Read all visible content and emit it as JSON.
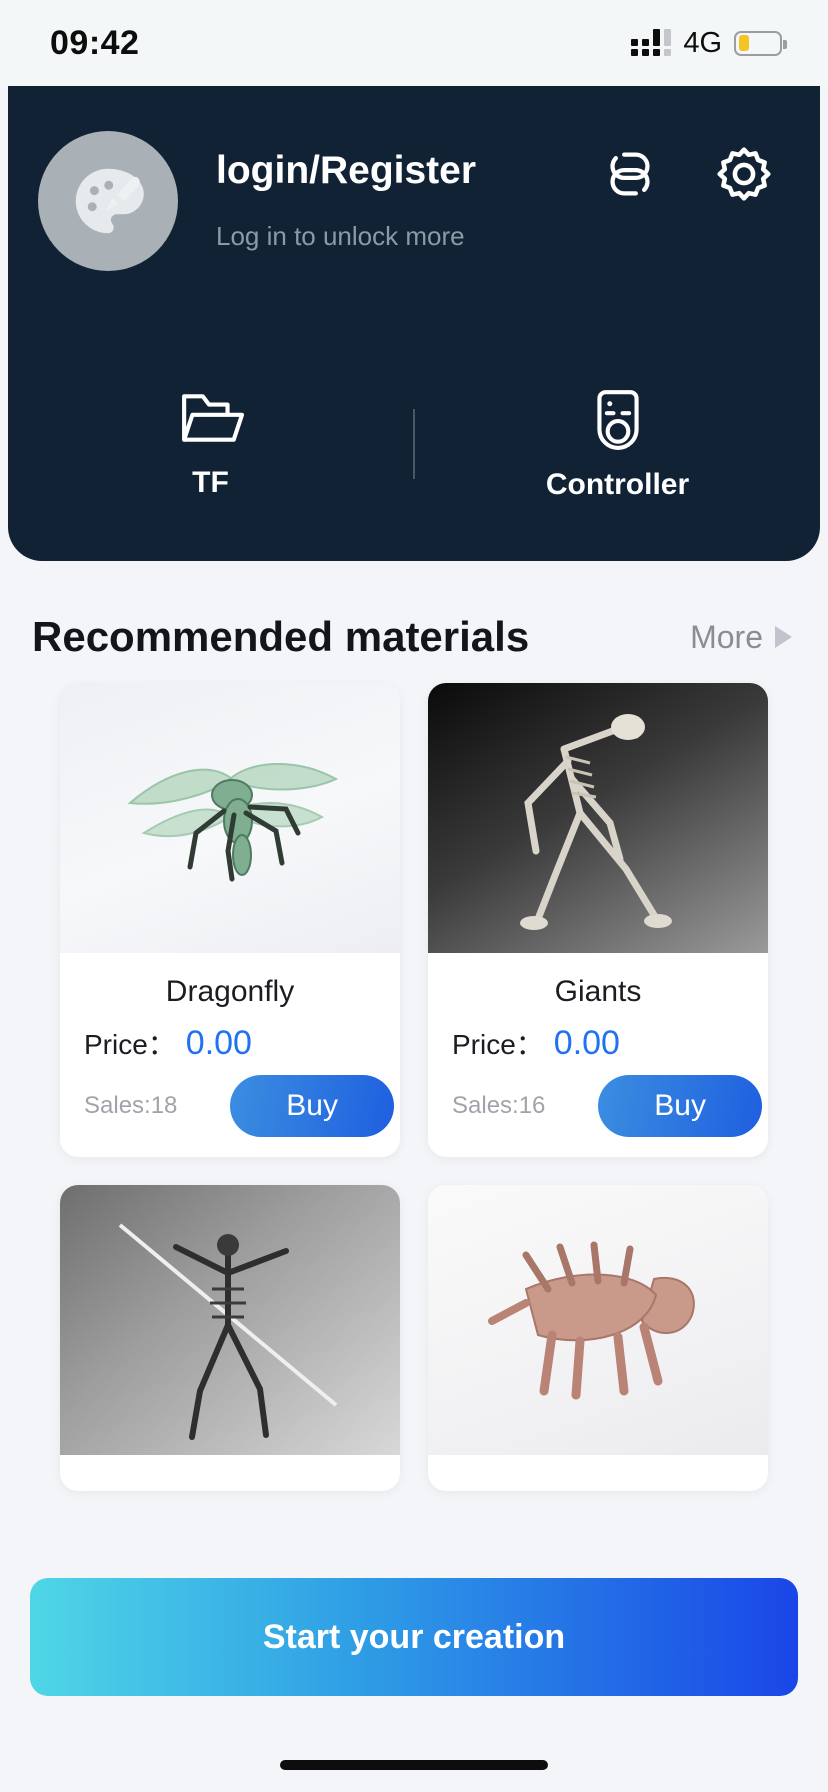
{
  "status_bar": {
    "time": "09:42",
    "network": "4G",
    "battery_level": "26",
    "signal_icon": "signal-bars-icon",
    "battery_icon": "battery-low-icon"
  },
  "header": {
    "avatar_icon": "palette-brush-avatar-icon",
    "title": "login/Register",
    "subtitle": "Log in to unlock more",
    "link_icon": "link-chain-icon",
    "settings_icon": "gear-icon",
    "shortcuts": [
      {
        "label": "TF",
        "icon": "folder-open-icon"
      },
      {
        "label": "Controller",
        "icon": "remote-controller-icon"
      }
    ],
    "background_color": "#102234"
  },
  "section": {
    "title": "Recommended materials",
    "more_label": "More",
    "more_icon": "triangle-right-icon"
  },
  "products": [
    {
      "name": "Dragonfly",
      "price_label": "Price：",
      "price": "0.00",
      "sales": "Sales:18",
      "buy_label": "Buy",
      "thumb_class": "thumb-dragonfly",
      "thumb_alt": "green dragonfly 3d model"
    },
    {
      "name": "Giants",
      "price_label": "Price：",
      "price": "0.00",
      "sales": "Sales:16",
      "buy_label": "Buy",
      "thumb_class": "thumb-giants",
      "thumb_alt": "giant skeleton 3d model"
    },
    {
      "name": "",
      "price_label": "",
      "price": "",
      "sales": "",
      "buy_label": "",
      "thumb_class": "thumb-warrior",
      "thumb_alt": "skeleton warrior with spear 3d model"
    },
    {
      "name": "",
      "price_label": "",
      "price": "",
      "sales": "",
      "buy_label": "",
      "thumb_class": "thumb-trike",
      "thumb_alt": "wooden triceratops 3d model"
    }
  ],
  "cta": {
    "label": "Start your creation",
    "accent_start": "#4fd6e6",
    "accent_end": "#1a46e8"
  },
  "colors": {
    "price_blue": "#2072f3",
    "header_dark": "#102234",
    "page_bg": "#f4f5f9"
  }
}
